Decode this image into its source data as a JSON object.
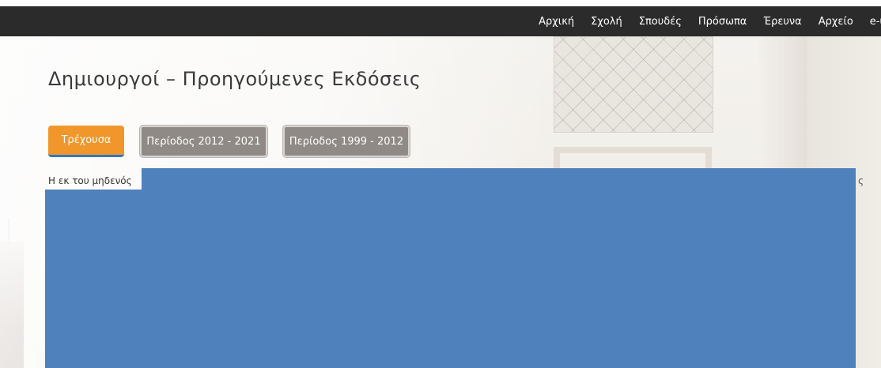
{
  "nav": {
    "items": [
      "Αρχική",
      "Σχολή",
      "Σπουδές",
      "Πρόσωπα",
      "Έρευνα",
      "Αρχείο",
      "e-υ"
    ]
  },
  "page": {
    "title": "Δημιουργοί – Προηγούμενες Εκδόσεις"
  },
  "tabs": {
    "current": "Τρέχουσα",
    "period_2012_2021": "Περίοδος 2012 - 2021",
    "period_1999_2012": "Περίοδος 1999 - 2012"
  },
  "content": {
    "intro_line_1": "Η εκ του μηδενός",
    "intro_line_2": "",
    "right_fragment": "ς"
  },
  "colors": {
    "topbar": "#2b2b2b",
    "tab_current": "#f0962a",
    "tab_inactive": "#8f8a86",
    "redaction": "#4f81bd"
  }
}
